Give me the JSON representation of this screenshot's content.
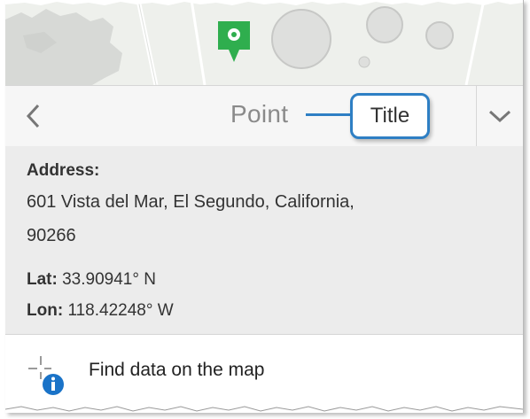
{
  "titlebar": {
    "back_icon": "chevron-left-icon",
    "title": "Point",
    "callout_label": "Title",
    "expand_icon": "chevron-down-icon"
  },
  "details": {
    "address_label": "Address:",
    "address_line1": "601 Vista del Mar, El Segundo, California,",
    "address_line2": "90266",
    "lat_label": "Lat:",
    "lat_value": "33.90941° N",
    "lon_label": "Lon:",
    "lon_value": "118.42248° W"
  },
  "find": {
    "label": "Find data on the map",
    "icon": "crosshair-info-icon"
  },
  "colors": {
    "pin": "#2fae4e",
    "accent": "#2e7fc4",
    "info": "#1a73c8"
  }
}
